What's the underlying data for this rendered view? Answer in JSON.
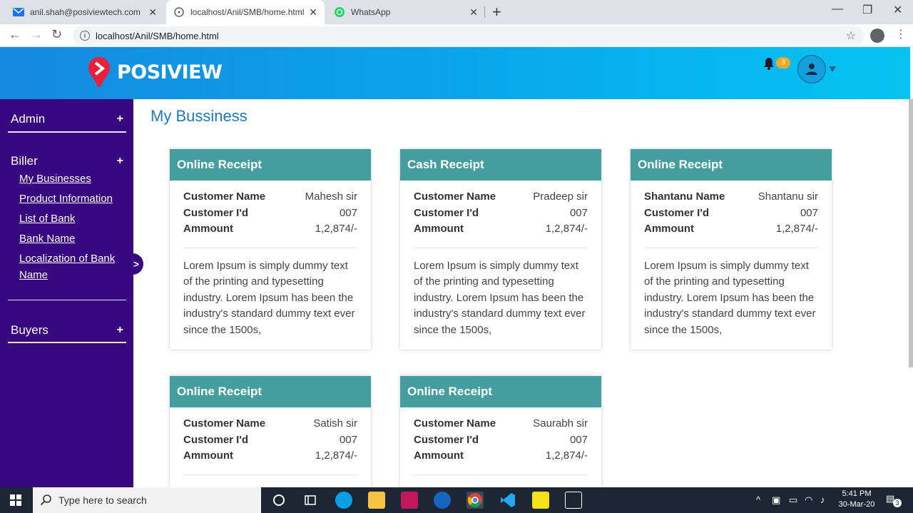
{
  "browser": {
    "tabs": [
      {
        "title": "anil.shah@posiviewtech.com",
        "icon": "mail-icon",
        "active": false
      },
      {
        "title": "localhost/Anil/SMB/home.html",
        "icon": "globe-icon",
        "active": true
      },
      {
        "title": "WhatsApp",
        "icon": "whatsapp-icon",
        "active": false
      }
    ],
    "url": "localhost/Anil/SMB/home.html"
  },
  "header": {
    "logo_text": "POSIVIEW",
    "notification_count": "3"
  },
  "sidebar": {
    "sections": [
      {
        "label": "Admin",
        "toggle": "+",
        "links": []
      },
      {
        "label": "Biller",
        "toggle": "+",
        "links": [
          "My Businesses",
          "Product Information",
          "List of Bank",
          "Bank Name",
          "Localization of Bank Name"
        ]
      },
      {
        "label": "Buyers",
        "toggle": "+",
        "links": []
      }
    ],
    "collapse_glyph": ">"
  },
  "main": {
    "title": "My Bussiness",
    "cards": [
      {
        "title": "Online Receipt",
        "rows": [
          {
            "k": "Customer Name",
            "v": "Mahesh sir"
          },
          {
            "k": "Customer I'd",
            "v": "007"
          },
          {
            "k": "Ammount",
            "v": "1,2,874/-"
          }
        ],
        "desc": "Lorem Ipsum is simply dummy text of the printing and typesetting industry. Lorem Ipsum has been the industry's standard dummy text ever since the 1500s,"
      },
      {
        "title": "Cash Receipt",
        "rows": [
          {
            "k": "Customer Name",
            "v": "Pradeep sir"
          },
          {
            "k": "Customer I'd",
            "v": "007"
          },
          {
            "k": "Ammount",
            "v": "1,2,874/-"
          }
        ],
        "desc": "Lorem Ipsum is simply dummy text of the printing and typesetting industry. Lorem Ipsum has been the industry's standard dummy text ever since the 1500s,"
      },
      {
        "title": "Online Receipt",
        "rows": [
          {
            "k": "Shantanu Name",
            "v": "Shantanu sir"
          },
          {
            "k": "Customer I'd",
            "v": "007"
          },
          {
            "k": "Ammount",
            "v": "1,2,874/-"
          }
        ],
        "desc": "Lorem Ipsum is simply dummy text of the printing and typesetting industry. Lorem Ipsum has been the industry's standard dummy text ever since the 1500s,"
      },
      {
        "title": "Online Receipt",
        "rows": [
          {
            "k": "Customer Name",
            "v": "Satish sir"
          },
          {
            "k": "Customer I'd",
            "v": "007"
          },
          {
            "k": "Ammount",
            "v": "1,2,874/-"
          }
        ],
        "desc": ""
      },
      {
        "title": "Online Receipt",
        "rows": [
          {
            "k": "Customer Name",
            "v": "Saurabh sir"
          },
          {
            "k": "Customer I'd",
            "v": "007"
          },
          {
            "k": "Ammount",
            "v": "1,2,874/-"
          }
        ],
        "desc": ""
      }
    ]
  },
  "taskbar": {
    "search_placeholder": "Type here to search",
    "time": "5:41 PM",
    "date": "30-Mar-20",
    "notification_count": "3"
  },
  "colors": {
    "header_gradient_start": "#1689e0",
    "header_gradient_end": "#06c4f2",
    "sidebar_bg": "#37087f",
    "card_header": "#459e9e",
    "title_blue": "#1a78c2",
    "badge_orange": "#f5a623"
  }
}
